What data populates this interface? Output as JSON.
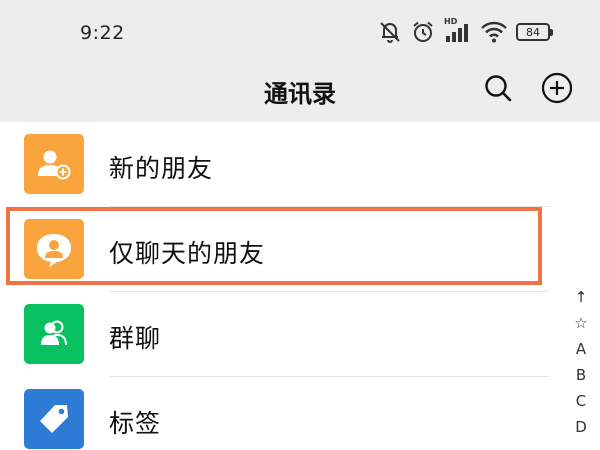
{
  "status_bar": {
    "time": "9:22",
    "battery": "84",
    "network_label": "HD",
    "icons": [
      "mute-bell-icon",
      "alarm-icon",
      "hd-signal-icon",
      "wifi-icon",
      "battery-icon"
    ]
  },
  "header": {
    "title": "通讯录",
    "search_icon": "search-icon",
    "add_icon": "add-circle-icon"
  },
  "contacts_menu": {
    "items": [
      {
        "label": "新的朋友",
        "icon": "add-friend-icon",
        "color": "#f9a43c"
      },
      {
        "label": "仅聊天的朋友",
        "icon": "chat-only-friend-icon",
        "color": "#f9a43c"
      },
      {
        "label": "群聊",
        "icon": "group-chat-icon",
        "color": "#07c160"
      },
      {
        "label": "标签",
        "icon": "tag-icon",
        "color": "#2e7bd6"
      }
    ],
    "highlighted_index": 1,
    "highlight_color": "#f07247"
  },
  "index_bar": [
    "↑",
    "☆",
    "A",
    "B",
    "C",
    "D"
  ]
}
